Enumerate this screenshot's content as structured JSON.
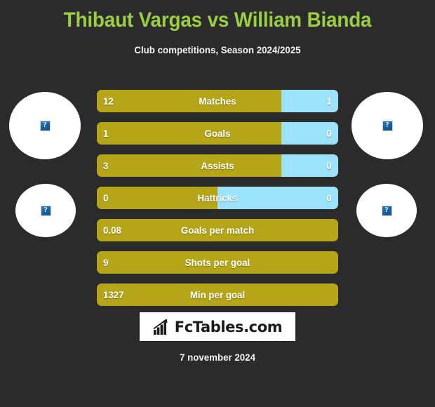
{
  "header": {
    "title": "Thibaut Vargas vs William Bianda",
    "subtitle": "Club competitions, Season 2024/2025",
    "title_color": "#9acd42",
    "subtitle_color": "#f2f2f2"
  },
  "theme": {
    "background": "#2b2b2b",
    "left_player_color": "#b5a518",
    "right_player_color": "#9ae3fb",
    "value_text_color": "#ffffff"
  },
  "photos": [
    {
      "name": "left-player-photo-primary",
      "alt": "?"
    },
    {
      "name": "left-player-photo-secondary",
      "alt": "?"
    },
    {
      "name": "right-player-photo-primary",
      "alt": "?"
    },
    {
      "name": "right-player-photo-secondary",
      "alt": "?"
    }
  ],
  "footer": {
    "logo_text": "FcTables.com",
    "logo_icon": "bar-chart-arrow-icon",
    "date": "7 november 2024"
  },
  "chart_data": {
    "type": "bar",
    "title": "Thibaut Vargas vs William Bianda",
    "subtitle": "Club competitions, Season 2024/2025",
    "xlabel": "",
    "ylabel": "",
    "grid": false,
    "legend_position": "none",
    "orientation": "horizontal-diverging",
    "categories": [
      "Matches",
      "Goals",
      "Assists",
      "Hattricks",
      "Goals per match",
      "Shots per goal",
      "Min per goal"
    ],
    "series": [
      {
        "name": "Thibaut Vargas",
        "color": "#b5a518",
        "values": [
          12,
          1,
          3,
          0,
          0.08,
          9,
          1327
        ],
        "labels": [
          "12",
          "1",
          "3",
          "0",
          "0.08",
          "9",
          "1327"
        ]
      },
      {
        "name": "William Bianda",
        "color": "#9ae3fb",
        "values": [
          1,
          0,
          0,
          0,
          null,
          null,
          null
        ],
        "labels": [
          "1",
          "0",
          "0",
          "0",
          "",
          "",
          ""
        ]
      }
    ],
    "rows": [
      {
        "label": "Matches",
        "left_value": "12",
        "right_value": "1",
        "left_pct": 76.5,
        "has_right": true
      },
      {
        "label": "Goals",
        "left_value": "1",
        "right_value": "0",
        "left_pct": 76.5,
        "has_right": true
      },
      {
        "label": "Assists",
        "left_value": "3",
        "right_value": "0",
        "left_pct": 76.5,
        "has_right": true
      },
      {
        "label": "Hattricks",
        "left_value": "0",
        "right_value": "0",
        "left_pct": 50.0,
        "has_right": true
      },
      {
        "label": "Goals per match",
        "left_value": "0.08",
        "right_value": "",
        "left_pct": 100,
        "has_right": false
      },
      {
        "label": "Shots per goal",
        "left_value": "9",
        "right_value": "",
        "left_pct": 100,
        "has_right": false
      },
      {
        "label": "Min per goal",
        "left_value": "1327",
        "right_value": "",
        "left_pct": 100,
        "has_right": false
      }
    ]
  }
}
